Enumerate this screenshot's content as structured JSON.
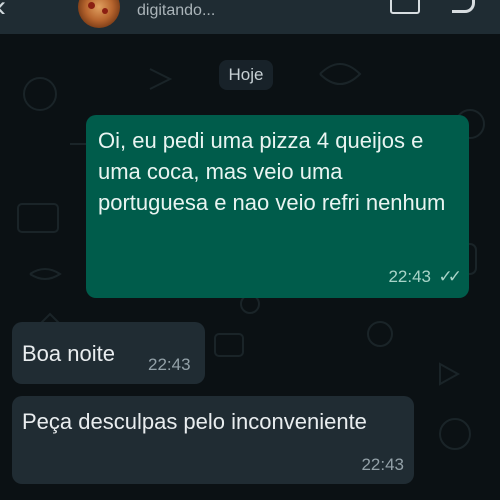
{
  "header": {
    "status": "digitando...",
    "back_icon": "arrow-left-icon",
    "avatar": "pizza-avatar",
    "video_icon": "video-call-icon",
    "call_icon": "phone-call-icon"
  },
  "chat": {
    "date_label": "Hoje",
    "messages": [
      {
        "direction": "outgoing",
        "text": "Oi, eu pedi uma pizza 4 queijos e uma coca, mas veio uma portuguesa e nao veio refri nenhum",
        "time": "22:43",
        "read_receipt": "✓✓"
      },
      {
        "direction": "incoming",
        "text": "Boa noite",
        "time": "22:43"
      },
      {
        "direction": "incoming",
        "text": "Peça desculpas pelo inconveniente",
        "time": "22:43"
      }
    ]
  },
  "colors": {
    "background": "#0b1114",
    "outgoing_bubble": "#005c4b",
    "incoming_bubble": "#202c33",
    "header": "#1f2c33"
  }
}
